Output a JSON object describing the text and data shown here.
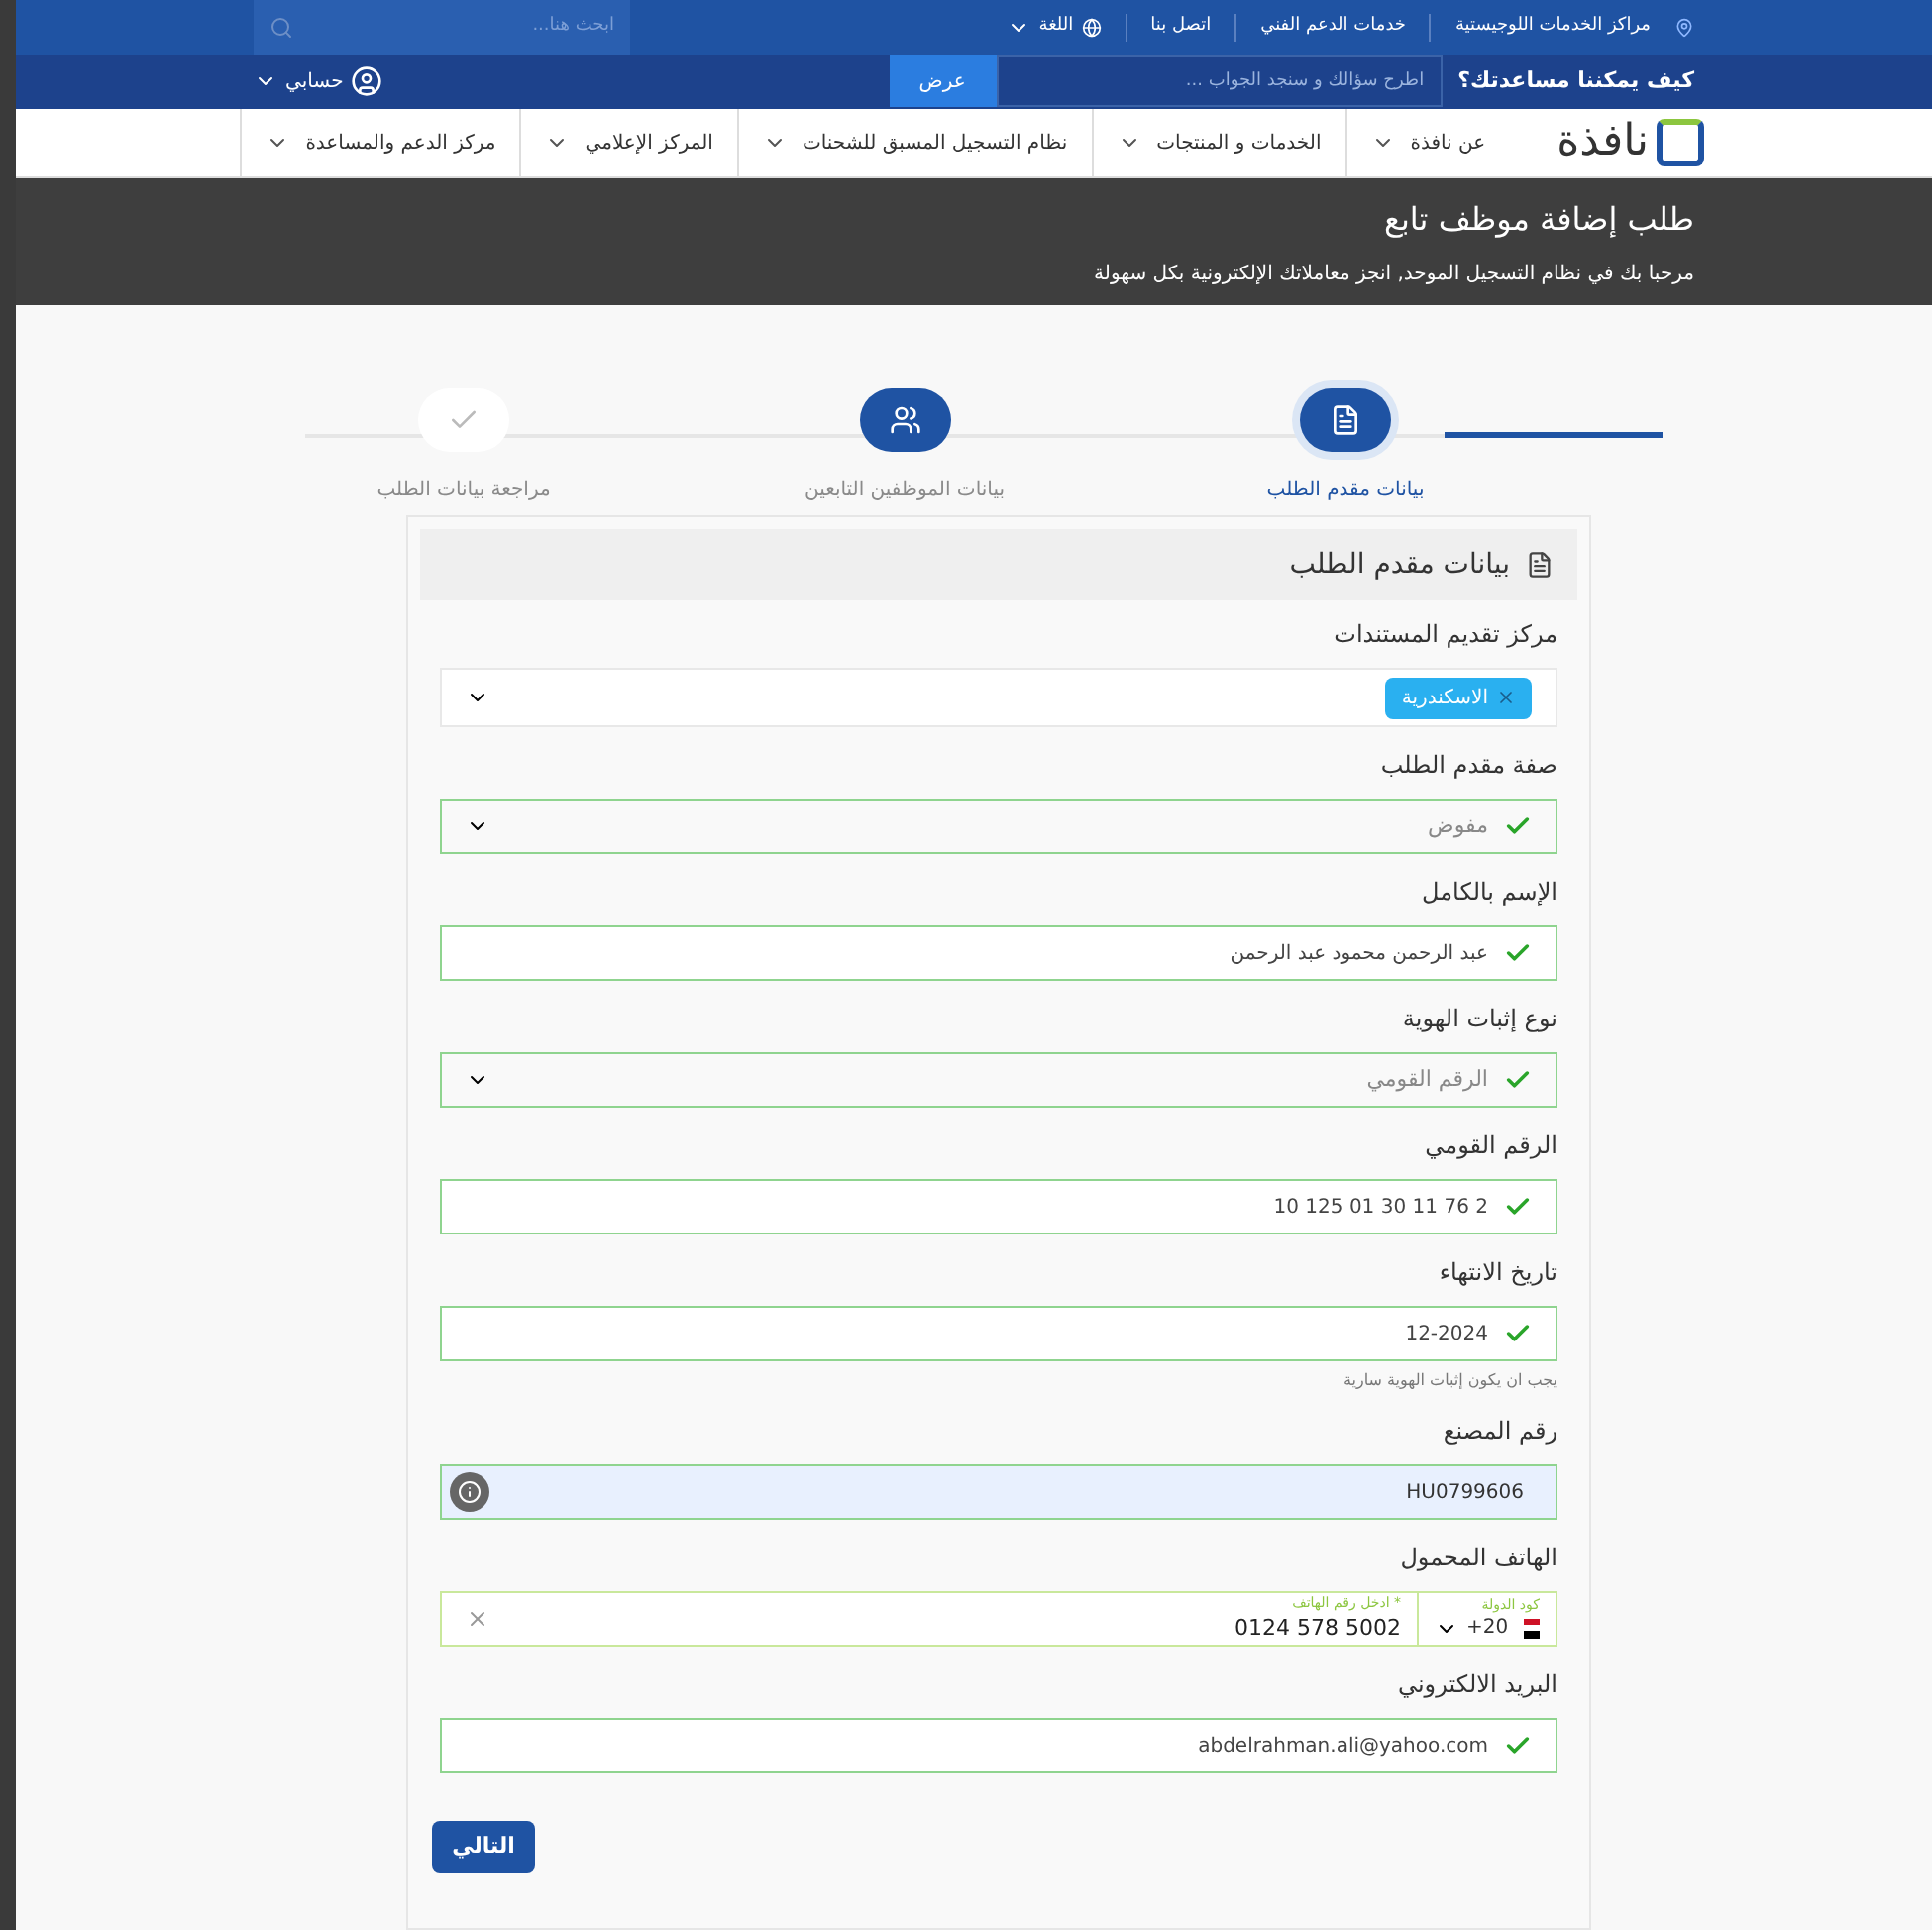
{
  "top_bar": {
    "links": [
      "مراكز الخدمات اللوجيستية",
      "خدمات الدعم الفني",
      "اتصل بنا"
    ],
    "language": "اللغة",
    "search": {
      "placeholder": "ابحث هنا..."
    }
  },
  "help_bar": {
    "question": "كيف يمكننا مساعدتك؟",
    "search": {
      "placeholder": "اطرح سؤالك و سنجد الجواب ..."
    },
    "button": "عرض",
    "account": "حسابي"
  },
  "nav": {
    "logo": "نافذة",
    "items": [
      "عن نافذة",
      "الخدمات و المنتجات",
      "نظام التسجيل المسبق للشحنات",
      "المركز الإعلامي",
      "مركز الدعم والمساعدة"
    ]
  },
  "header": {
    "title": "طلب إضافة موظف تابع",
    "subtitle": "مرحبا بك في نظام التسجيل الموحد, انجز معاملاتك الإلكترونية بكل سهولة"
  },
  "steps": [
    {
      "label": "بيانات مقدم الطلب",
      "kind": "form",
      "selected": true
    },
    {
      "label": "بيانات الموظفين التابعين",
      "kind": "people",
      "selected": false
    },
    {
      "label": "مراجعة بيانات الطلب",
      "kind": "review",
      "selected": false
    }
  ],
  "form": {
    "title": "بيانات مقدم الطلب",
    "fields": [
      {
        "kind": "tags",
        "label": "مركز تقديم المستندات",
        "tags": [
          "الاسكندرية"
        ]
      },
      {
        "kind": "select",
        "label": "صفة مقدم الطلب",
        "value": "مفوض",
        "valid": true
      },
      {
        "kind": "text",
        "label": "الإسم بالكامل",
        "value": "عبد الرحمن محمود عبد الرحمن",
        "valid": true
      },
      {
        "kind": "select",
        "label": "نوع إثبات الهوية",
        "value": "الرقم القومي",
        "valid": true
      },
      {
        "kind": "text",
        "label": "الرقم القومي",
        "value": "2 76 11 30 01 125 10",
        "valid": true
      },
      {
        "kind": "text",
        "label": "تاريخ الانتهاء",
        "value": "12-2024",
        "valid": true,
        "hint": "يجب ان يكون إثبات الهوية سارية"
      },
      {
        "kind": "info",
        "label": "رقم المصنع",
        "value": "HU0799606"
      },
      {
        "kind": "phone",
        "label": "الهاتف المحمول",
        "country_label": "كود الدولة",
        "country_code": "+20",
        "number_label": "* ادخل رقم الهاتف",
        "number": "0124 578 5002"
      },
      {
        "kind": "text",
        "label": "البريد الالكتروني",
        "value": "abdelrahman.ali@yahoo.com",
        "valid": true
      }
    ],
    "next_button": "التالي"
  }
}
